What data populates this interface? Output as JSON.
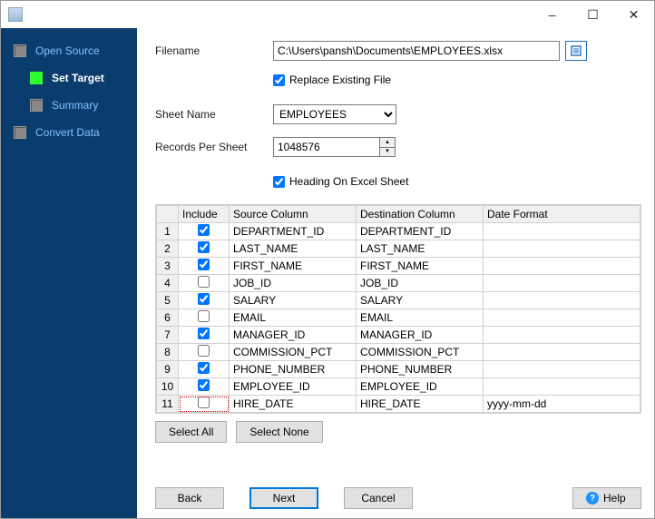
{
  "titlebar": {
    "minimize": "–",
    "maximize": "☐",
    "close": "✕"
  },
  "nav": {
    "items": [
      {
        "label": "Open Source",
        "active": false,
        "indent": false
      },
      {
        "label": "Set Target",
        "active": true,
        "indent": true
      },
      {
        "label": "Summary",
        "active": false,
        "indent": true
      },
      {
        "label": "Convert Data",
        "active": false,
        "indent": false
      }
    ]
  },
  "form": {
    "filename_label": "Filename",
    "filename_value": "C:\\Users\\pansh\\Documents\\EMPLOYEES.xlsx",
    "replace_existing_label": "Replace Existing File",
    "replace_existing_checked": true,
    "sheet_name_label": "Sheet Name",
    "sheet_name_value": "EMPLOYEES",
    "records_per_sheet_label": "Records Per Sheet",
    "records_per_sheet_value": "1048576",
    "heading_label": "Heading On Excel Sheet",
    "heading_checked": true
  },
  "grid": {
    "headers": {
      "include": "Include",
      "source": "Source Column",
      "dest": "Destination Column",
      "datefmt": "Date Format"
    },
    "rows": [
      {
        "idx": "1",
        "include": true,
        "source": "DEPARTMENT_ID",
        "dest": "DEPARTMENT_ID",
        "datefmt": ""
      },
      {
        "idx": "2",
        "include": true,
        "source": "LAST_NAME",
        "dest": "LAST_NAME",
        "datefmt": ""
      },
      {
        "idx": "3",
        "include": true,
        "source": "FIRST_NAME",
        "dest": "FIRST_NAME",
        "datefmt": ""
      },
      {
        "idx": "4",
        "include": false,
        "source": "JOB_ID",
        "dest": "JOB_ID",
        "datefmt": ""
      },
      {
        "idx": "5",
        "include": true,
        "source": "SALARY",
        "dest": "SALARY",
        "datefmt": ""
      },
      {
        "idx": "6",
        "include": false,
        "source": "EMAIL",
        "dest": "EMAIL",
        "datefmt": ""
      },
      {
        "idx": "7",
        "include": true,
        "source": "MANAGER_ID",
        "dest": "MANAGER_ID",
        "datefmt": ""
      },
      {
        "idx": "8",
        "include": false,
        "source": "COMMISSION_PCT",
        "dest": "COMMISSION_PCT",
        "datefmt": ""
      },
      {
        "idx": "9",
        "include": true,
        "source": "PHONE_NUMBER",
        "dest": "PHONE_NUMBER",
        "datefmt": ""
      },
      {
        "idx": "10",
        "include": true,
        "source": "EMPLOYEE_ID",
        "dest": "EMPLOYEE_ID",
        "datefmt": ""
      },
      {
        "idx": "11",
        "include": false,
        "source": "HIRE_DATE",
        "dest": "HIRE_DATE",
        "datefmt": "yyyy-mm-dd"
      }
    ]
  },
  "buttons": {
    "select_all": "Select All",
    "select_none": "Select None",
    "back": "Back",
    "next": "Next",
    "cancel": "Cancel",
    "help": "Help"
  }
}
